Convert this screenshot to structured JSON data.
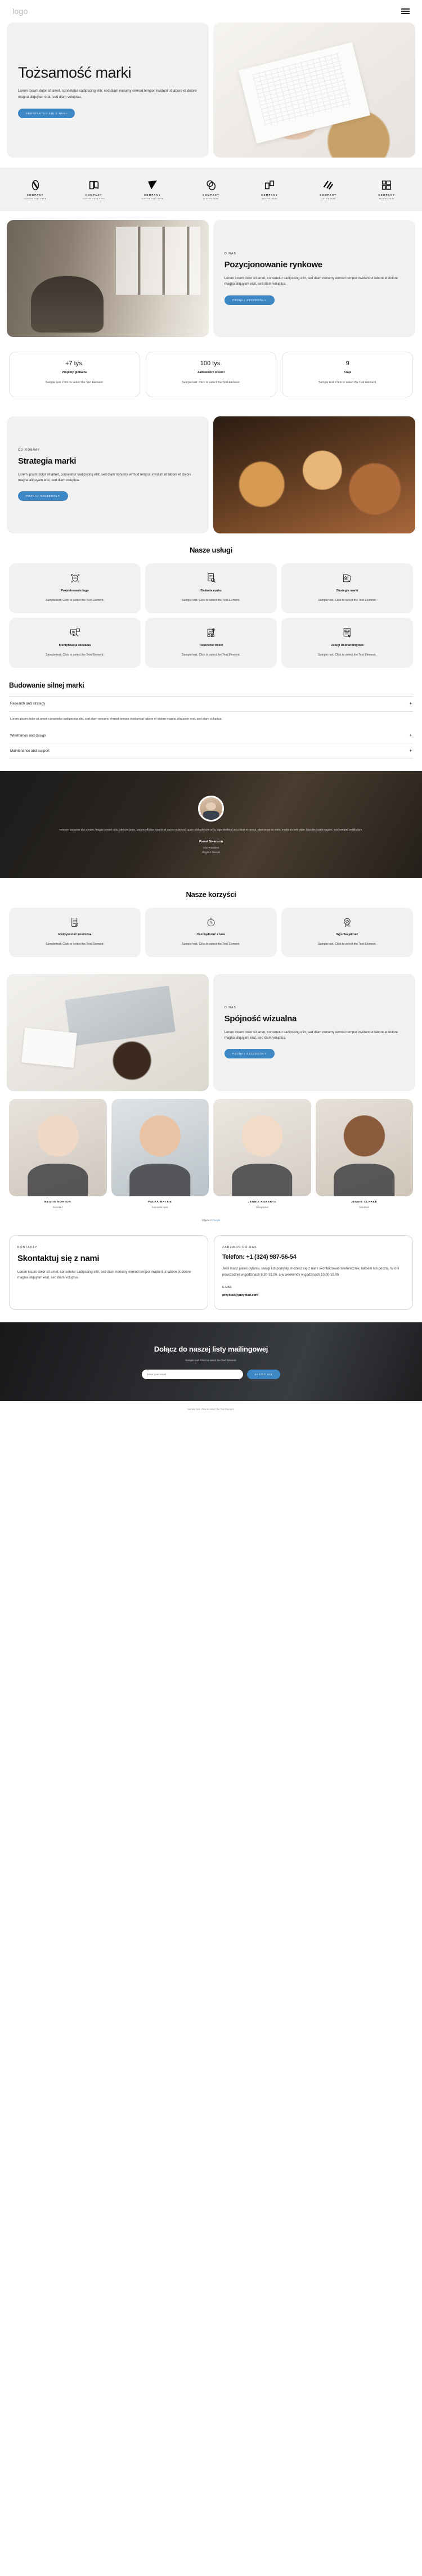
{
  "header": {
    "logo": "logo",
    "menu_icon": "hamburger-menu-icon"
  },
  "hero": {
    "title": "Tożsamość marki",
    "text": "Lorem ipsum dolor sit amet, consetetur sadipscing elitr, sed diam nonumy eirmod tempor invidunt ut labore et dolore magna aliquyam erat, sed diam voluptua.",
    "cta": "SKONTAKTUJ SIĘ Z NAMI"
  },
  "logos": [
    {
      "name": "COMPANY",
      "tagline": "TAGLINE GOES HERE"
    },
    {
      "name": "COMPANY",
      "tagline": "TAGLINE GOES HERE"
    },
    {
      "name": "COMPANY",
      "tagline": "TAGLINE GOES HERE"
    },
    {
      "name": "COMPANY",
      "tagline": "TAGLINE HERE"
    },
    {
      "name": "COMPANY",
      "tagline": "TAGLINE HERE"
    },
    {
      "name": "COMPANY",
      "tagline": "TAGLINE HERE"
    },
    {
      "name": "COMPANY",
      "tagline": "TAGLINE HERE"
    }
  ],
  "about": {
    "eyebrow": "O NAS",
    "title": "Pozycjonowanie rynkowe",
    "text": "Lorem ipsum dolor sit amet, consetetur sadipscing elitr, sed diam nonumy eirmod tempor invidunt ut labore et dolore magna aliquyam erat, sed diam voluptua.",
    "cta": "POZNAJ SZCZEGÓŁY"
  },
  "stats": [
    {
      "number": "+7 tys.",
      "label": "Projekty globalne",
      "desc": "Sample text. Click to select the Text Element."
    },
    {
      "number": "100 tys.",
      "label": "Zadowoleni klienci",
      "desc": "Sample text. Click to select the Text Element."
    },
    {
      "number": "9",
      "label": "Kraje",
      "desc": "Sample text. Click to select the Text Element."
    }
  ],
  "strategy": {
    "eyebrow": "CO ROBIMY",
    "title": "Strategia marki",
    "text": "Lorem ipsum dolor sit amet, consetetur sadipscing elitr, sed diam nonumy eirmod tempor invidunt ut labore et dolore magna aliquyam erat, sed diam voluptua.",
    "cta": "POZNAJ SZCZEGÓŁY"
  },
  "services": {
    "title": "Nasze usługi",
    "items": [
      {
        "icon": "logo-design-icon",
        "title": "Projektowanie logo",
        "desc": "Sample text. Click to select the Text Element."
      },
      {
        "icon": "market-research-icon",
        "title": "Badania rynku",
        "desc": "Sample text. Click to select the Text Element."
      },
      {
        "icon": "brand-strategy-icon",
        "title": "Strategia marki",
        "desc": "Sample text. Click to select the Text Element."
      },
      {
        "icon": "visual-identity-icon",
        "title": "Identyfikacja wizualna",
        "desc": "Sample text. Click to select the Text Element."
      },
      {
        "icon": "content-creation-icon",
        "title": "Tworzenie treści",
        "desc": "Sample text. Click to select the Text Element."
      },
      {
        "icon": "rebranding-icon",
        "title": "Usługi Rebrandingowe",
        "desc": "Sample text. Click to select the Text Element."
      }
    ]
  },
  "accordion": {
    "title": "Budowanie silnej marki",
    "items": [
      {
        "label": "Research and strategy",
        "sign": "+",
        "open": true,
        "body": "Lorem ipsum dolor sit amet, consetetur sadipscing elitr, sed diam nonumy eirmod tempor invidunt ut labore et dolore magna aliquyam erat, sed diam voluptua."
      },
      {
        "label": "Wireframes and design",
        "sign": "+",
        "open": false,
        "body": ""
      },
      {
        "label": "Maintenance and support",
        "sign": "+",
        "open": false,
        "body": ""
      }
    ]
  },
  "testimonial": {
    "quote": "Nemore pudanae dus ornare, feugiat ornare nidu, ultricies justo. Mauris efficitur mauris sit auctor euismod, quam nibh ultricies urna, eget eleifend arcu risus et metus. Maecenas ex enim, mattis eu velit vitae, blandits mattis sapien. Sed semper vestibulum.",
    "name": "Paweł Swanson",
    "role": "Vice President",
    "company": "Objęta z Freepik"
  },
  "benefits": {
    "title": "Nasze korzyści",
    "items": [
      {
        "icon": "cost-effective-icon",
        "title": "Efektywność kosztowa",
        "desc": "Sample text. Click to select the Text Element."
      },
      {
        "icon": "time-saving-icon",
        "title": "Oszczędność czasu",
        "desc": "Sample text. Click to select the Text Element."
      },
      {
        "icon": "high-quality-icon",
        "title": "Wysoka jakość",
        "desc": "Sample text. Click to select the Text Element."
      }
    ]
  },
  "visual": {
    "eyebrow": "O NAS",
    "title": "Spójność wizualna",
    "text": "Lorem ipsum dolor sit amet, consetetur sadipscing elitr, sed diam nonumy eirmod tempor invidunt ut labore et dolore magna aliquyam erat, sed diam voluptua.",
    "cta": "POZNAJ SZCZEGÓŁY"
  },
  "team": {
    "members": [
      {
        "name": "BESTIE NORTON",
        "role": "Sekretarz"
      },
      {
        "name": "PAŁAA MATTIE",
        "role": "Kierownik biura"
      },
      {
        "name": "JENNIE ROBERTS",
        "role": "Wiceprezes"
      },
      {
        "name": "JENNIE CLARKE",
        "role": "Sekretarz"
      }
    ],
    "credit_prefix": "Zdjęcie z ",
    "credit_link": "Freepik"
  },
  "contact": {
    "left": {
      "eyebrow": "KONTAKTY",
      "title": "Skontaktuj się z nami",
      "text": "Lorem ipsum dolor sit amet, consetetur sadipscing elitr, sed diam nonumy eirmod tempor invidunt ut labore et dolore magna aliquyam erat, sed diam voluptua."
    },
    "right": {
      "eyebrow": "ZADZWOŃ DO NAS",
      "phone": "Telefon: +1 (324) 987-56-54",
      "text": "Jeśli masz jakieś pytania, uwagi lub pomysły, możesz się z nami skontaktować telefonicznie, faksem lub pocztą. W dni powszednie w godzinach 8.30-19.00, a w weekendy w godzinach 10.00-19.00",
      "email_label": "E-MAIL",
      "email": "przykład@przykład.com"
    }
  },
  "newsletter": {
    "title": "Dołącz do naszej listy mailingowej",
    "subtitle": "Sample text. Click to select the Text Element.",
    "input_placeholder": "Enter your email",
    "button": "ZAPISZ SIĘ"
  },
  "footer": {
    "note": "Sample text. Click to select the Text Element."
  },
  "colors": {
    "accent": "#3c87c4",
    "surface": "#f1f1f1",
    "text": "#1a1a1a"
  }
}
